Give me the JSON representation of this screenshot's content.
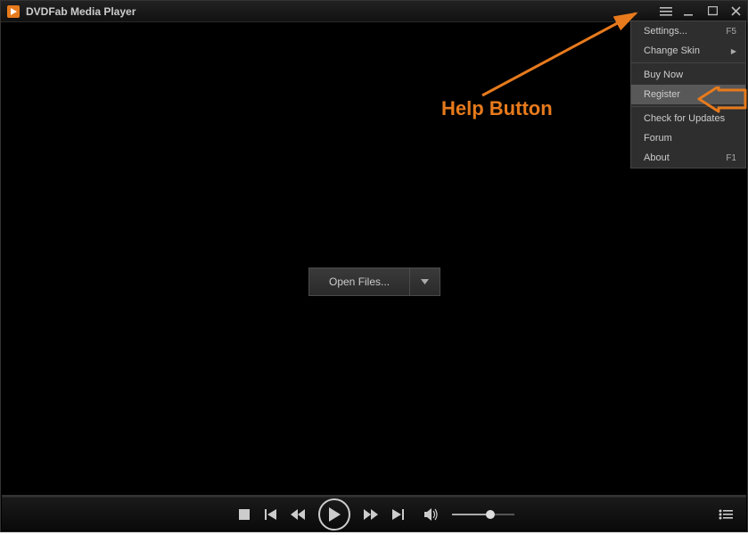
{
  "titlebar": {
    "title": "DVDFab Media Player"
  },
  "main": {
    "open_files_label": "Open Files..."
  },
  "menu": {
    "items": [
      {
        "label": "Settings...",
        "shortcut": "F5",
        "type": "item"
      },
      {
        "label": "Change Skin",
        "type": "submenu"
      },
      {
        "type": "sep"
      },
      {
        "label": "Buy Now",
        "type": "item"
      },
      {
        "label": "Register",
        "type": "item",
        "highlight": true
      },
      {
        "type": "sep"
      },
      {
        "label": "Check for Updates",
        "type": "item"
      },
      {
        "label": "Forum",
        "type": "item"
      },
      {
        "label": "About",
        "shortcut": "F1",
        "type": "item"
      }
    ]
  },
  "annotation": {
    "help_label": "Help Button"
  },
  "colors": {
    "accent": "#e77a1c"
  }
}
